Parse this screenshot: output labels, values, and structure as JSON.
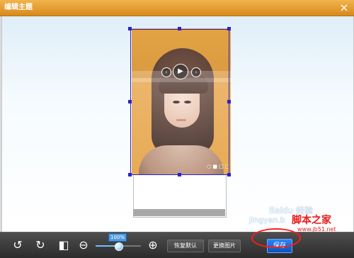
{
  "window": {
    "title": "编辑主题",
    "close_icon": "close-icon"
  },
  "photo": {
    "media": {
      "prev": "‹",
      "play": "▶",
      "next": "›"
    },
    "tiny_text": "○ ■ □ □"
  },
  "toolbar": {
    "rotate_left_icon": "rotate-left-icon",
    "rotate_right_icon": "rotate-right-icon",
    "flip_icon": "flip-icon",
    "zoom_out_icon": "zoom-out-icon",
    "zoom_in_icon": "zoom-in-icon",
    "zoom_level": "100%",
    "zoom_fraction": 0.45,
    "restore_default_label": "恢复默认",
    "replace_image_label": "更换图片",
    "save_label": "保存"
  },
  "watermarks": {
    "baidu": "Baidu 经验",
    "url": "jingyan.b",
    "site": "脚本之家",
    "site_url": "www.jb51.net"
  },
  "colors": {
    "accent": "#2b23c9",
    "titlebar": "#e49a2f",
    "annotation": "#ff1b1b",
    "save": "#1c6be0"
  }
}
